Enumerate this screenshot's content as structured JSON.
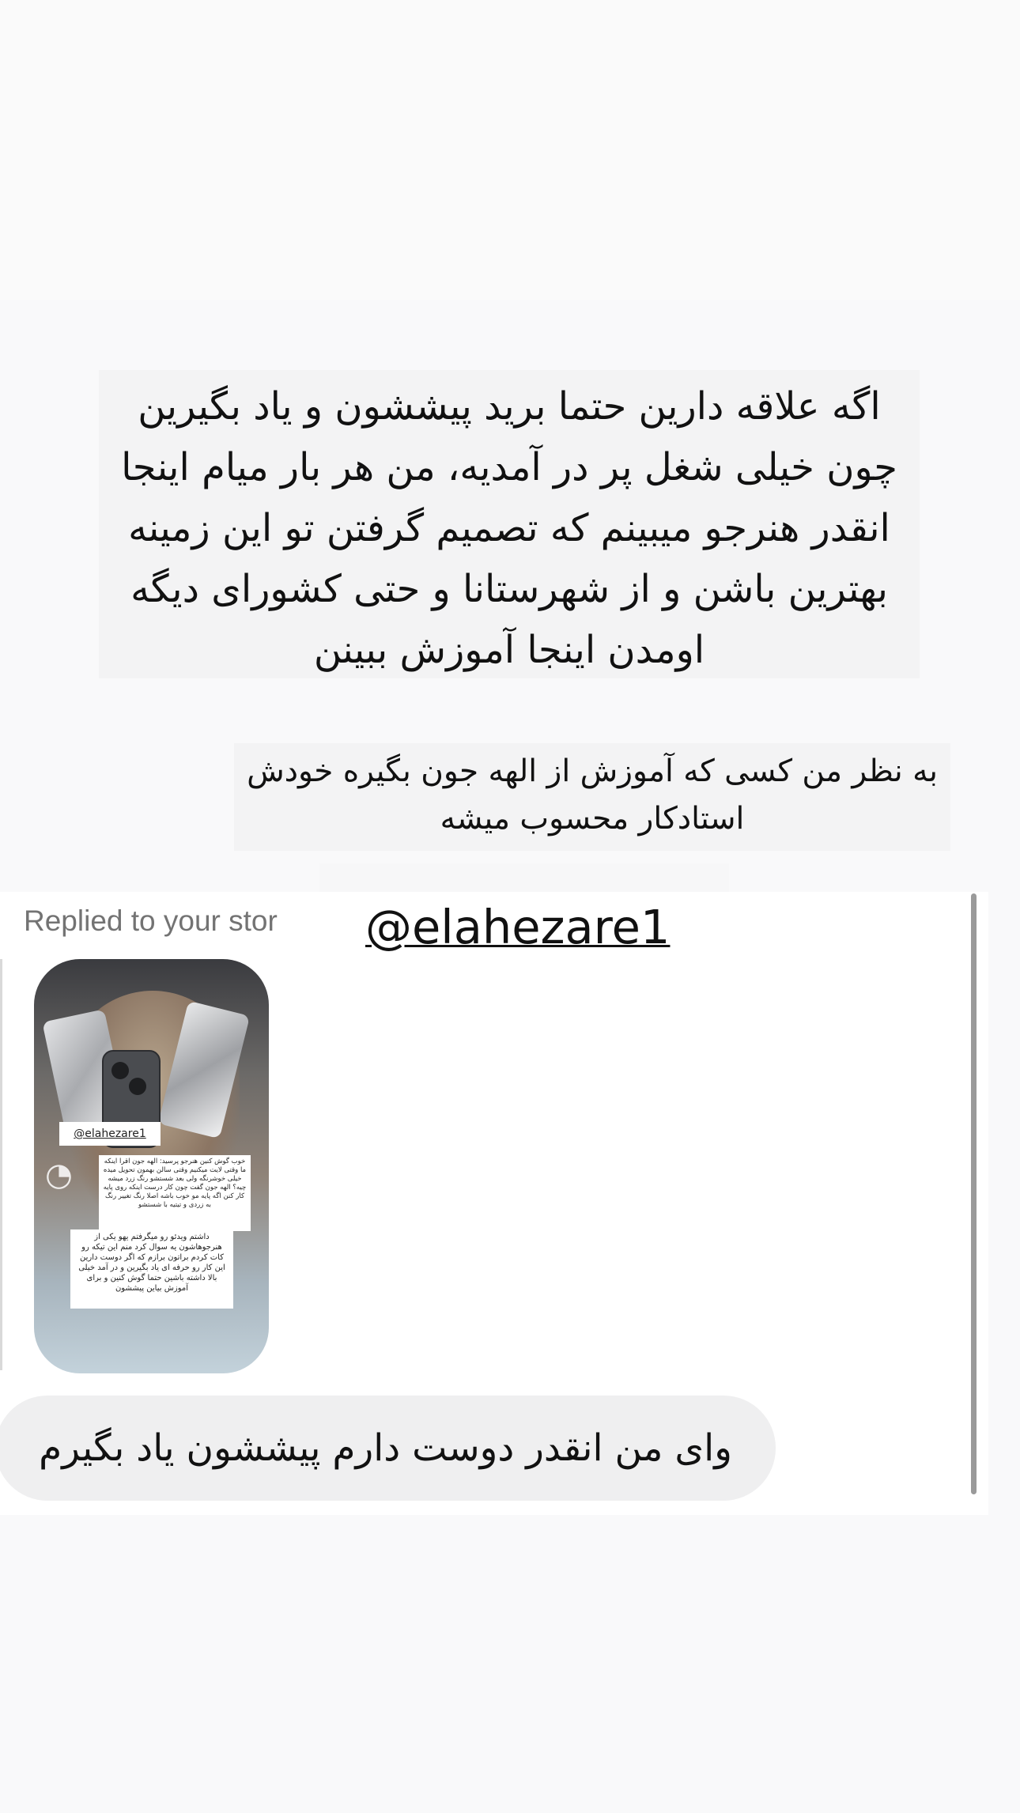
{
  "caption_main": {
    "lines": [
      "اگه علاقه دارین حتما برید پیششون و یاد بگیرین",
      "چون خیلی شغل پر در آمدیه، من هر بار میام اینجا",
      "انقدر هنرجو میبینم که تصمیم گرفتن تو این زمینه",
      "بهترین باشن و از شهرستانا و حتی کشورای دیگه",
      "اومدن اینجا آموزش ببینن"
    ]
  },
  "caption_sub": {
    "lines": [
      "به نظر من کسی که آموزش از الهه جون بگیره خودش",
      "استادکار محسوب میشه"
    ]
  },
  "dm": {
    "replied_label": "Replied to your stor",
    "mention": "@elahezare1",
    "story_thumbnail": {
      "tag": "@elahezare1",
      "note1": "خوب گوش کنین هنرجو پرسید: الهه جون اقرا اینکه ما وقتی لایت میکنیم وقتی سالن بهمون تحویل میده خیلی خوشرنگه ولی بعد شستشو رنگ زرد میشه چیه؟ الهه جون گفت چون کار درست اینکه روی پایه کار کنن اگه پایه مو خوب باشه اصلا رنگ تغییر رنگ به زردی و تیتیه با شستشو",
      "note2": "داشتم ویدئو رو میگرفتم یهو یکی از هنرجوهاشون یه سوال کرد منم این تیکه رو کات کردم براتون برازم که اگر دوست دارین این کار رو حرفه ای یاد بگیرین و در آمد خیلی بالا داشته باشین حتما گوش کنین و برای آموزش بیاین پیششون"
    },
    "message": "وای من انقدر دوست دارم پیششون یاد بگیرم"
  },
  "colors": {
    "page_bg": "#f9f9fa",
    "caption_bg": "#f3f3f4",
    "bubble_bg": "#efeff0",
    "replied_text": "#737373"
  },
  "icons": [
    "sound-wave-icon"
  ]
}
